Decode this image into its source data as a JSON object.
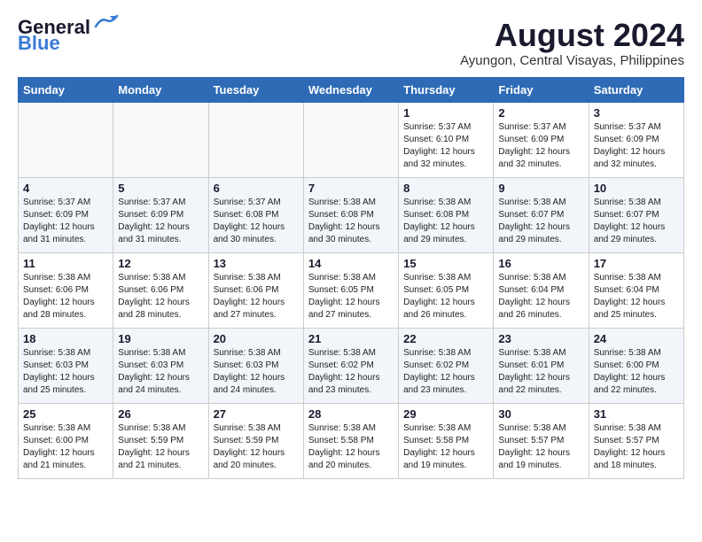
{
  "logo": {
    "line1": "General",
    "line2": "Blue"
  },
  "title": "August 2024",
  "subtitle": "Ayungon, Central Visayas, Philippines",
  "days_of_week": [
    "Sunday",
    "Monday",
    "Tuesday",
    "Wednesday",
    "Thursday",
    "Friday",
    "Saturday"
  ],
  "weeks": [
    [
      {
        "day": "",
        "info": ""
      },
      {
        "day": "",
        "info": ""
      },
      {
        "day": "",
        "info": ""
      },
      {
        "day": "",
        "info": ""
      },
      {
        "day": "1",
        "info": "Sunrise: 5:37 AM\nSunset: 6:10 PM\nDaylight: 12 hours\nand 32 minutes."
      },
      {
        "day": "2",
        "info": "Sunrise: 5:37 AM\nSunset: 6:09 PM\nDaylight: 12 hours\nand 32 minutes."
      },
      {
        "day": "3",
        "info": "Sunrise: 5:37 AM\nSunset: 6:09 PM\nDaylight: 12 hours\nand 32 minutes."
      }
    ],
    [
      {
        "day": "4",
        "info": "Sunrise: 5:37 AM\nSunset: 6:09 PM\nDaylight: 12 hours\nand 31 minutes."
      },
      {
        "day": "5",
        "info": "Sunrise: 5:37 AM\nSunset: 6:09 PM\nDaylight: 12 hours\nand 31 minutes."
      },
      {
        "day": "6",
        "info": "Sunrise: 5:37 AM\nSunset: 6:08 PM\nDaylight: 12 hours\nand 30 minutes."
      },
      {
        "day": "7",
        "info": "Sunrise: 5:38 AM\nSunset: 6:08 PM\nDaylight: 12 hours\nand 30 minutes."
      },
      {
        "day": "8",
        "info": "Sunrise: 5:38 AM\nSunset: 6:08 PM\nDaylight: 12 hours\nand 29 minutes."
      },
      {
        "day": "9",
        "info": "Sunrise: 5:38 AM\nSunset: 6:07 PM\nDaylight: 12 hours\nand 29 minutes."
      },
      {
        "day": "10",
        "info": "Sunrise: 5:38 AM\nSunset: 6:07 PM\nDaylight: 12 hours\nand 29 minutes."
      }
    ],
    [
      {
        "day": "11",
        "info": "Sunrise: 5:38 AM\nSunset: 6:06 PM\nDaylight: 12 hours\nand 28 minutes."
      },
      {
        "day": "12",
        "info": "Sunrise: 5:38 AM\nSunset: 6:06 PM\nDaylight: 12 hours\nand 28 minutes."
      },
      {
        "day": "13",
        "info": "Sunrise: 5:38 AM\nSunset: 6:06 PM\nDaylight: 12 hours\nand 27 minutes."
      },
      {
        "day": "14",
        "info": "Sunrise: 5:38 AM\nSunset: 6:05 PM\nDaylight: 12 hours\nand 27 minutes."
      },
      {
        "day": "15",
        "info": "Sunrise: 5:38 AM\nSunset: 6:05 PM\nDaylight: 12 hours\nand 26 minutes."
      },
      {
        "day": "16",
        "info": "Sunrise: 5:38 AM\nSunset: 6:04 PM\nDaylight: 12 hours\nand 26 minutes."
      },
      {
        "day": "17",
        "info": "Sunrise: 5:38 AM\nSunset: 6:04 PM\nDaylight: 12 hours\nand 25 minutes."
      }
    ],
    [
      {
        "day": "18",
        "info": "Sunrise: 5:38 AM\nSunset: 6:03 PM\nDaylight: 12 hours\nand 25 minutes."
      },
      {
        "day": "19",
        "info": "Sunrise: 5:38 AM\nSunset: 6:03 PM\nDaylight: 12 hours\nand 24 minutes."
      },
      {
        "day": "20",
        "info": "Sunrise: 5:38 AM\nSunset: 6:03 PM\nDaylight: 12 hours\nand 24 minutes."
      },
      {
        "day": "21",
        "info": "Sunrise: 5:38 AM\nSunset: 6:02 PM\nDaylight: 12 hours\nand 23 minutes."
      },
      {
        "day": "22",
        "info": "Sunrise: 5:38 AM\nSunset: 6:02 PM\nDaylight: 12 hours\nand 23 minutes."
      },
      {
        "day": "23",
        "info": "Sunrise: 5:38 AM\nSunset: 6:01 PM\nDaylight: 12 hours\nand 22 minutes."
      },
      {
        "day": "24",
        "info": "Sunrise: 5:38 AM\nSunset: 6:00 PM\nDaylight: 12 hours\nand 22 minutes."
      }
    ],
    [
      {
        "day": "25",
        "info": "Sunrise: 5:38 AM\nSunset: 6:00 PM\nDaylight: 12 hours\nand 21 minutes."
      },
      {
        "day": "26",
        "info": "Sunrise: 5:38 AM\nSunset: 5:59 PM\nDaylight: 12 hours\nand 21 minutes."
      },
      {
        "day": "27",
        "info": "Sunrise: 5:38 AM\nSunset: 5:59 PM\nDaylight: 12 hours\nand 20 minutes."
      },
      {
        "day": "28",
        "info": "Sunrise: 5:38 AM\nSunset: 5:58 PM\nDaylight: 12 hours\nand 20 minutes."
      },
      {
        "day": "29",
        "info": "Sunrise: 5:38 AM\nSunset: 5:58 PM\nDaylight: 12 hours\nand 19 minutes."
      },
      {
        "day": "30",
        "info": "Sunrise: 5:38 AM\nSunset: 5:57 PM\nDaylight: 12 hours\nand 19 minutes."
      },
      {
        "day": "31",
        "info": "Sunrise: 5:38 AM\nSunset: 5:57 PM\nDaylight: 12 hours\nand 18 minutes."
      }
    ]
  ]
}
